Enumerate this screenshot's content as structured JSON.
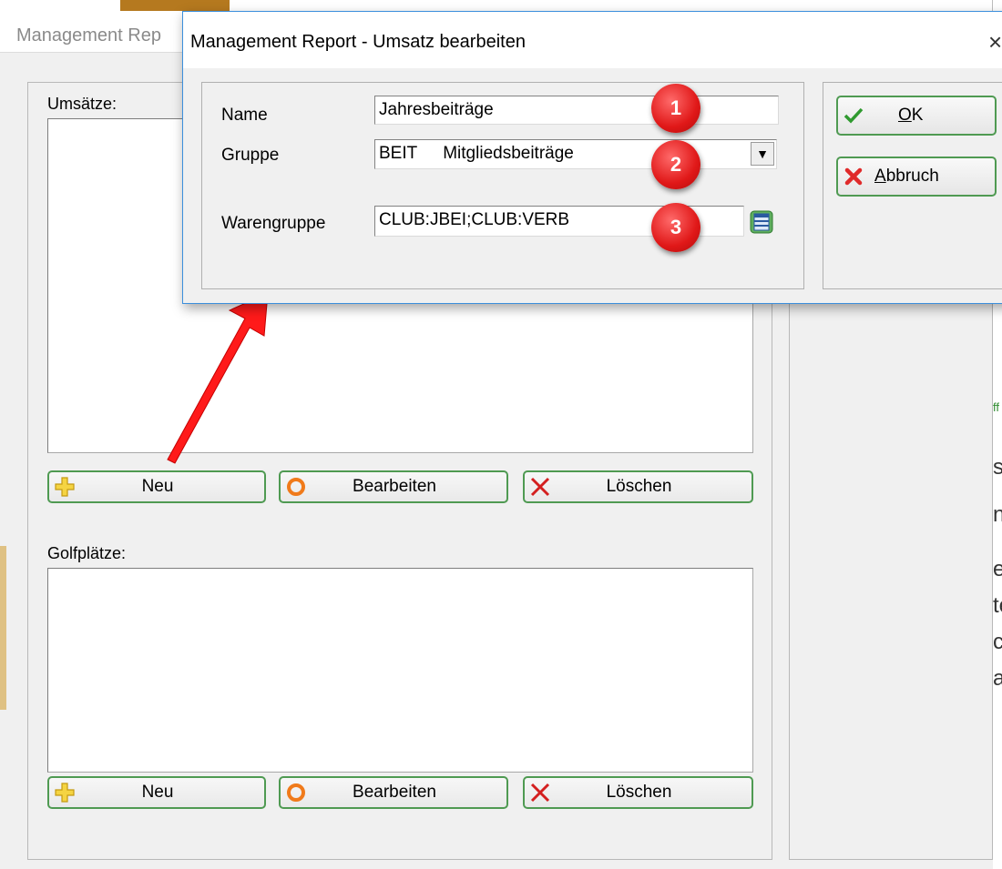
{
  "background_window": {
    "title": "Management Rep",
    "umsaetze": {
      "label": "Umsätze:",
      "buttons": {
        "new": "Neu",
        "edit": "Bearbeiten",
        "delete": "Löschen"
      }
    },
    "golfplaetze": {
      "label": "Golfplätze:",
      "buttons": {
        "new": "Neu",
        "edit": "Bearbeiten",
        "delete": "Löschen"
      }
    },
    "right_edge_fragments": [
      "ff",
      "st",
      "n",
      "e",
      "te",
      "c",
      "a"
    ]
  },
  "dialog": {
    "title": "Management Report - Umsatz bearbeiten",
    "close_glyph": "×",
    "fields": {
      "name": {
        "label": "Name",
        "value": "Jahresbeiträge"
      },
      "gruppe": {
        "label": "Gruppe",
        "code": "BEIT",
        "text": "Mitgliedsbeiträge"
      },
      "warengruppe": {
        "label": "Warengruppe",
        "value": "CLUB:JBEI;CLUB:VERB"
      }
    },
    "buttons": {
      "ok": {
        "label_underlined": "O",
        "label_rest": "K"
      },
      "cancel": {
        "label_underlined": "A",
        "label_rest": "bbruch"
      }
    }
  },
  "annotations": {
    "badges": [
      "1",
      "2",
      "3"
    ],
    "arrow_color": "#ff1a1a"
  },
  "icons": {
    "new": "plus-icon",
    "edit": "circle-icon",
    "delete": "x-icon",
    "ok": "checkmark-icon",
    "cancel": "x-icon",
    "lookup": "list-lookup-icon"
  }
}
